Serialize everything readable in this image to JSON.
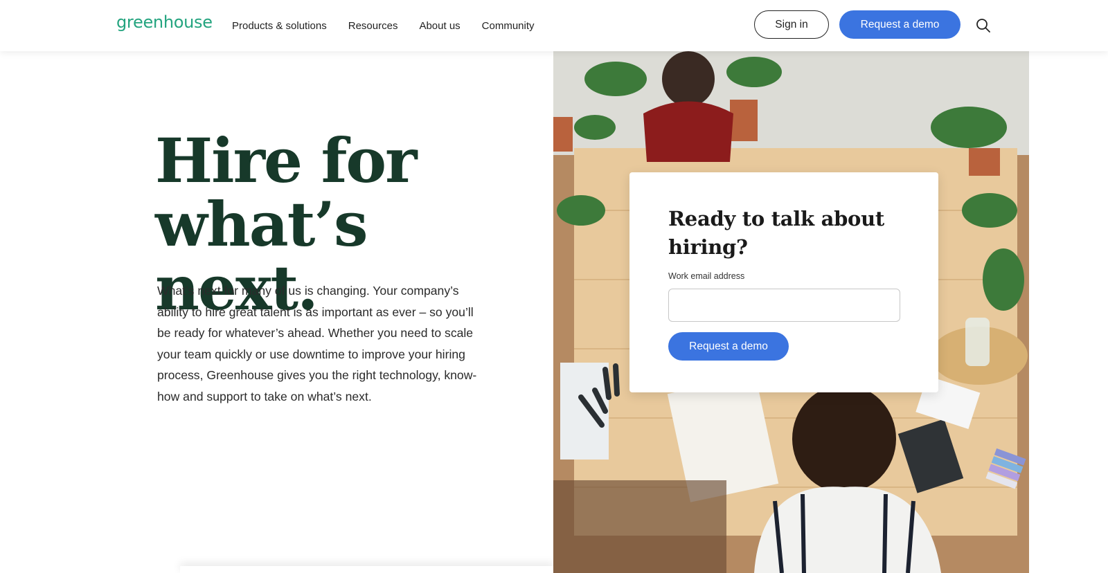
{
  "header": {
    "logo": "greenhouse",
    "nav": [
      "Products & solutions",
      "Resources",
      "About us",
      "Community"
    ],
    "sign_in": "Sign in",
    "request_demo": "Request a demo",
    "search_icon": "search-icon"
  },
  "hero": {
    "title_line1": "Hire for",
    "title_line2": "what’s next.",
    "body": "What’s next for many of us is changing. Your company’s ability to hire great talent is as important as ever – so you’ll be ready for whatever’s ahead. Whether you need to scale your team quickly or use downtime to improve your hiring process, Greenhouse gives you the right technology, know-how and support to take on what’s next."
  },
  "card": {
    "title": "Ready to talk about hiring?",
    "email_label": "Work email address",
    "email_value": "",
    "email_placeholder": "",
    "submit": "Request a demo"
  },
  "colors": {
    "brand_green": "#24a47f",
    "heading_green": "#17392a",
    "accent_blue": "#3b74e0"
  }
}
